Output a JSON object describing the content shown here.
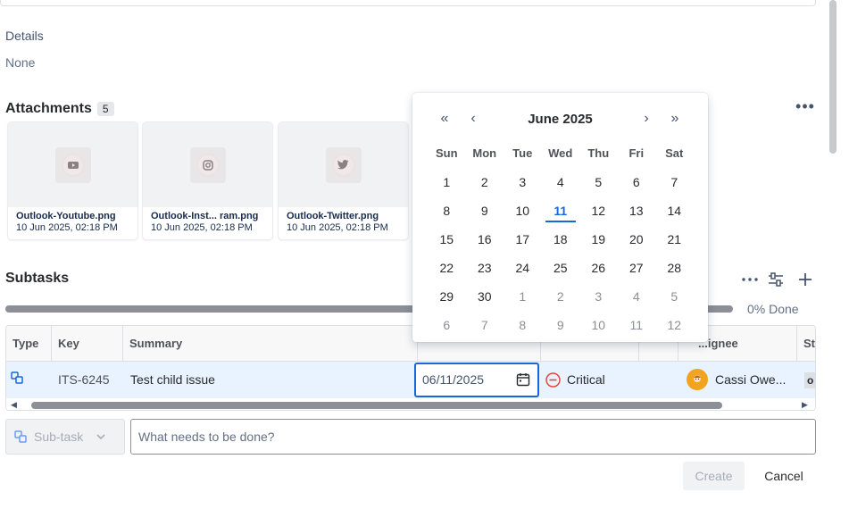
{
  "details": {
    "label": "Details",
    "value": "None"
  },
  "attachments": {
    "title": "Attachments",
    "count": "5",
    "items": [
      {
        "name": "Outlook-Youtube.png",
        "date": "10 Jun 2025, 02:18 PM",
        "icon": "youtube-icon"
      },
      {
        "name": "Outlook-Inst... ram.png",
        "date": "10 Jun 2025, 02:18 PM",
        "icon": "instagram-icon"
      },
      {
        "name": "Outlook-Twitter.png",
        "date": "10 Jun 2025, 02:18 PM",
        "icon": "twitter-icon"
      }
    ]
  },
  "subtasks": {
    "title": "Subtasks",
    "progress_text": "0% Done",
    "progress_fraction": 0,
    "columns": {
      "type": "Type",
      "key": "Key",
      "summary": "Summary",
      "assignee": "...ignee",
      "status": "St"
    },
    "row": {
      "key": "ITS-6245",
      "summary": "Test child issue",
      "due_date": "06/11/2025",
      "priority": "Critical",
      "assignee": "Cassi Owe...",
      "status": "o"
    }
  },
  "create_bar": {
    "type_label": "Sub-task",
    "placeholder": "What needs to be done?",
    "create_label": "Create",
    "cancel_label": "Cancel"
  },
  "calendar": {
    "title": "June 2025",
    "weekdays": [
      "Sun",
      "Mon",
      "Tue",
      "Wed",
      "Thu",
      "Fri",
      "Sat"
    ],
    "weeks": [
      [
        "1",
        "2",
        "3",
        "4",
        "5",
        "6",
        "7"
      ],
      [
        "8",
        "9",
        "10",
        "11",
        "12",
        "13",
        "14"
      ],
      [
        "15",
        "16",
        "17",
        "18",
        "19",
        "20",
        "21"
      ],
      [
        "22",
        "23",
        "24",
        "25",
        "26",
        "27",
        "28"
      ],
      [
        "29",
        "30",
        "1",
        "2",
        "3",
        "4",
        "5"
      ],
      [
        "6",
        "7",
        "8",
        "9",
        "10",
        "11",
        "12"
      ]
    ],
    "today": "11"
  },
  "colors": {
    "accent": "#1868db",
    "critical": "#e2483d",
    "row_highlight": "#e9f2ff"
  }
}
